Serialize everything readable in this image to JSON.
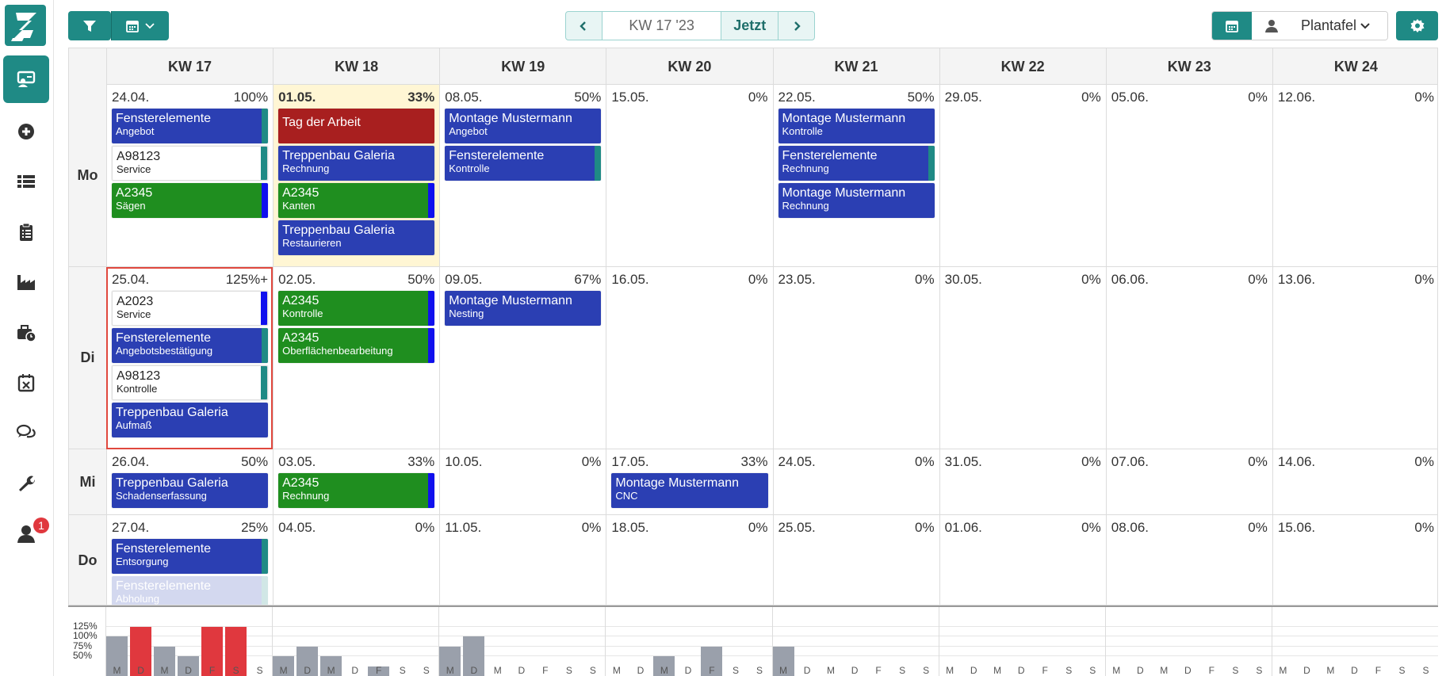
{
  "toolbar": {
    "week_label": "KW 17 '23",
    "now_label": "Jetzt",
    "view_label": "Plantafel"
  },
  "notifications": {
    "count": "1"
  },
  "sidebar": {
    "items": [
      "monitor-user-icon",
      "plus-circle-icon",
      "list-icon",
      "clipboard-icon",
      "factory-icon",
      "toolbox-clock-icon",
      "calendar-x-icon",
      "chat-icon",
      "wrench-icon",
      "user-icon"
    ]
  },
  "weeks": [
    "KW 17",
    "KW 18",
    "KW 19",
    "KW 20",
    "KW 21",
    "KW 22",
    "KW 23",
    "KW 24"
  ],
  "rows": [
    {
      "label": "Mo",
      "cells": [
        {
          "date": "24.04.",
          "pct": "100%",
          "tasks": [
            {
              "title": "Fensterelemente",
              "sub": "Angebot",
              "color": "blue",
              "stripe": "#1f8a85"
            },
            {
              "title": "A98123",
              "sub": "Service",
              "color": "white",
              "stripe": "#1f8a85"
            },
            {
              "title": "A2345",
              "sub": "Sägen",
              "color": "green",
              "stripe": "#1010ee"
            }
          ]
        },
        {
          "date": "01.05.",
          "pct": "33%",
          "holiday": true,
          "tasks": [
            {
              "title": "Tag der Arbeit",
              "sub": "",
              "color": "red",
              "stripe": ""
            },
            {
              "title": "Treppenbau Galeria",
              "sub": "Rechnung",
              "color": "blue",
              "stripe": ""
            },
            {
              "title": "A2345",
              "sub": "Kanten",
              "color": "green",
              "stripe": "#1010ee"
            },
            {
              "title": "Treppenbau Galeria",
              "sub": "Restaurieren",
              "color": "blue",
              "stripe": ""
            }
          ]
        },
        {
          "date": "08.05.",
          "pct": "50%",
          "tasks": [
            {
              "title": "Montage Mustermann",
              "sub": "Angebot",
              "color": "blue",
              "stripe": ""
            },
            {
              "title": "Fensterelemente",
              "sub": "Kontrolle",
              "color": "blue",
              "stripe": "#1f8a85"
            }
          ]
        },
        {
          "date": "15.05.",
          "pct": "0%",
          "tasks": []
        },
        {
          "date": "22.05.",
          "pct": "50%",
          "tasks": [
            {
              "title": "Montage Mustermann",
              "sub": "Kontrolle",
              "color": "blue",
              "stripe": ""
            },
            {
              "title": "Fensterelemente",
              "sub": "Rechnung",
              "color": "blue",
              "stripe": "#1f8a85"
            },
            {
              "title": "Montage Mustermann",
              "sub": "Rechnung",
              "color": "blue",
              "stripe": ""
            }
          ]
        },
        {
          "date": "29.05.",
          "pct": "0%",
          "tasks": []
        },
        {
          "date": "05.06.",
          "pct": "0%",
          "tasks": []
        },
        {
          "date": "12.06.",
          "pct": "0%",
          "tasks": []
        }
      ]
    },
    {
      "label": "Di",
      "cells": [
        {
          "date": "25.04.",
          "pct": "125%+",
          "selected": true,
          "tasks": [
            {
              "title": "A2023",
              "sub": "Service",
              "color": "white",
              "stripe": "#1010ee"
            },
            {
              "title": "Fensterelemente",
              "sub": "Angebotsbestätigung",
              "color": "blue",
              "stripe": "#1f8a85"
            },
            {
              "title": "A98123",
              "sub": "Kontrolle",
              "color": "white",
              "stripe": "#1f8a85"
            },
            {
              "title": "Treppenbau Galeria",
              "sub": "Aufmaß",
              "color": "blue",
              "stripe": ""
            }
          ]
        },
        {
          "date": "02.05.",
          "pct": "50%",
          "tasks": [
            {
              "title": "A2345",
              "sub": "Kontrolle",
              "color": "green",
              "stripe": "#1010ee"
            },
            {
              "title": "A2345",
              "sub": "Oberflächenbearbeitung",
              "color": "green",
              "stripe": "#1010ee"
            }
          ]
        },
        {
          "date": "09.05.",
          "pct": "67%",
          "tasks": [
            {
              "title": "Montage Mustermann",
              "sub": "Nesting",
              "color": "blue",
              "stripe": ""
            }
          ]
        },
        {
          "date": "16.05.",
          "pct": "0%",
          "tasks": []
        },
        {
          "date": "23.05.",
          "pct": "0%",
          "tasks": []
        },
        {
          "date": "30.05.",
          "pct": "0%",
          "tasks": []
        },
        {
          "date": "06.06.",
          "pct": "0%",
          "tasks": []
        },
        {
          "date": "13.06.",
          "pct": "0%",
          "tasks": []
        }
      ]
    },
    {
      "label": "Mi",
      "cells": [
        {
          "date": "26.04.",
          "pct": "50%",
          "tasks": [
            {
              "title": "Treppenbau Galeria",
              "sub": "Schadenserfassung",
              "color": "blue",
              "stripe": ""
            }
          ]
        },
        {
          "date": "03.05.",
          "pct": "33%",
          "tasks": [
            {
              "title": "A2345",
              "sub": "Rechnung",
              "color": "green",
              "stripe": "#1010ee"
            }
          ]
        },
        {
          "date": "10.05.",
          "pct": "0%",
          "tasks": []
        },
        {
          "date": "17.05.",
          "pct": "33%",
          "tasks": [
            {
              "title": "Montage Mustermann",
              "sub": "CNC",
              "color": "blue",
              "stripe": ""
            }
          ]
        },
        {
          "date": "24.05.",
          "pct": "0%",
          "tasks": []
        },
        {
          "date": "31.05.",
          "pct": "0%",
          "tasks": []
        },
        {
          "date": "07.06.",
          "pct": "0%",
          "tasks": []
        },
        {
          "date": "14.06.",
          "pct": "0%",
          "tasks": []
        }
      ]
    },
    {
      "label": "Do",
      "cells": [
        {
          "date": "27.04.",
          "pct": "25%",
          "tasks": [
            {
              "title": "Fensterelemente",
              "sub": "Entsorgung",
              "color": "blue",
              "stripe": "#1f8a85"
            },
            {
              "title": "Fensterelemente",
              "sub": "Abholung",
              "color": "blue",
              "stripe": "#1f8a85",
              "faded": true
            }
          ]
        },
        {
          "date": "04.05.",
          "pct": "0%",
          "tasks": []
        },
        {
          "date": "11.05.",
          "pct": "0%",
          "tasks": []
        },
        {
          "date": "18.05.",
          "pct": "0%",
          "tasks": []
        },
        {
          "date": "25.05.",
          "pct": "0%",
          "tasks": []
        },
        {
          "date": "01.06.",
          "pct": "0%",
          "tasks": []
        },
        {
          "date": "08.06.",
          "pct": "0%",
          "tasks": []
        },
        {
          "date": "15.06.",
          "pct": "0%",
          "tasks": []
        }
      ]
    }
  ],
  "capacity": {
    "y_ticks": [
      "125%",
      "100%",
      "75%",
      "50%"
    ],
    "day_letters": [
      "M",
      "D",
      "M",
      "D",
      "F",
      "S",
      "S"
    ],
    "values": [
      [
        100,
        125,
        75,
        50,
        125,
        125,
        0
      ],
      [
        50,
        75,
        50,
        0,
        25,
        0,
        0
      ],
      [
        75,
        100,
        0,
        0,
        0,
        0,
        0
      ],
      [
        0,
        0,
        50,
        0,
        75,
        0,
        0
      ],
      [
        75,
        0,
        0,
        0,
        0,
        0,
        0
      ],
      [
        0,
        0,
        0,
        0,
        0,
        0,
        0
      ],
      [
        0,
        0,
        0,
        0,
        0,
        0,
        0
      ],
      [
        0,
        0,
        0,
        0,
        0,
        0,
        0
      ]
    ],
    "overload_color": "#e0383e",
    "normal_color": "#9aa0ab"
  }
}
